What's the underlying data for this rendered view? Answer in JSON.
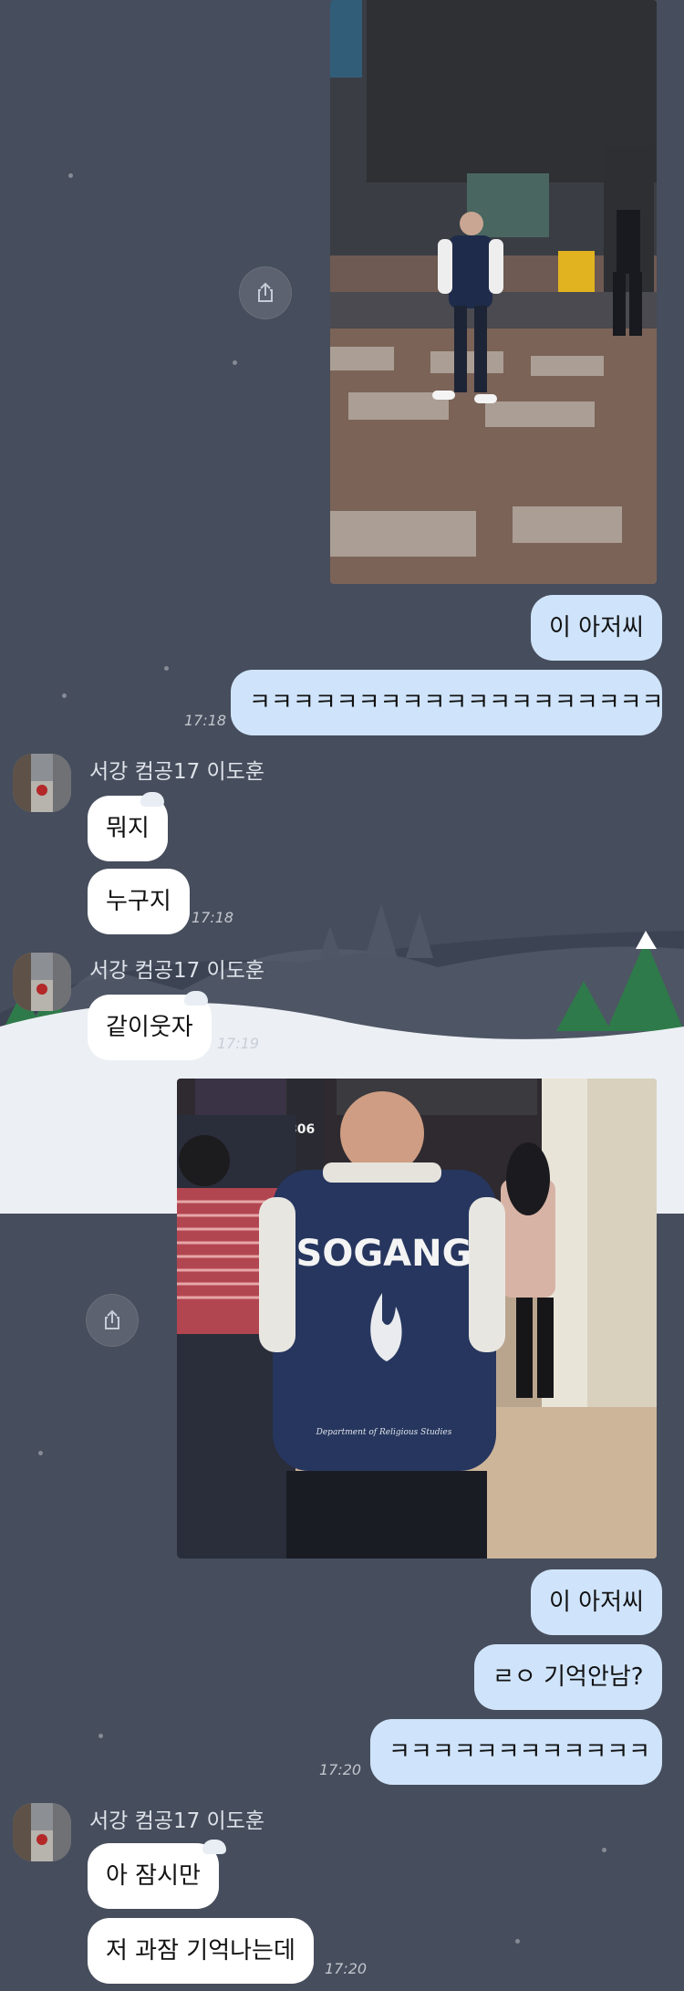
{
  "theme": {
    "background": "#464d5c",
    "outgoing_bubble": "#cfe4fb",
    "incoming_bubble": "#ffffff"
  },
  "messages": [
    {
      "id": "m1",
      "direction": "out",
      "type": "image",
      "image_desc": "person-walking-street-photo"
    },
    {
      "id": "m2",
      "direction": "out",
      "text": "이 아저씨"
    },
    {
      "id": "m3",
      "direction": "out",
      "text": "ㅋㅋㅋㅋㅋㅋㅋㅋㅋㅋㅋㅋㅋㅋㅋㅋㅋㅋㅋ",
      "time": "17:18"
    },
    {
      "id": "m4",
      "direction": "in",
      "sender": "서강 컴공17 이도훈",
      "text": "뭐지"
    },
    {
      "id": "m5",
      "direction": "in",
      "text": "누구지",
      "time": "17:18"
    },
    {
      "id": "m6",
      "direction": "in",
      "sender": "서강 컴공17 이도훈",
      "text": "같이웃자",
      "time": "17:19"
    },
    {
      "id": "m7",
      "direction": "out",
      "type": "image",
      "image_desc": "sogang-jacket-hallway-photo",
      "jacket_text": "SOGANG",
      "jacket_small": "Department of Religious Studies",
      "sign_number": "306"
    },
    {
      "id": "m8",
      "direction": "out",
      "text": "이 아저씨"
    },
    {
      "id": "m9",
      "direction": "out",
      "text": "ㄹㅇ 기억안남?"
    },
    {
      "id": "m10",
      "direction": "out",
      "text": "ㅋㅋㅋㅋㅋㅋㅋㅋㅋㅋㅋㅋ",
      "time": "17:20"
    },
    {
      "id": "m11",
      "direction": "in",
      "sender": "서강 컴공17 이도훈",
      "text": "아 잠시만"
    },
    {
      "id": "m12",
      "direction": "in",
      "text": "저 과잠 기억나는데",
      "time": "17:20"
    }
  ],
  "icons": {
    "share": "share-icon",
    "avatar": "avatar-icon"
  }
}
